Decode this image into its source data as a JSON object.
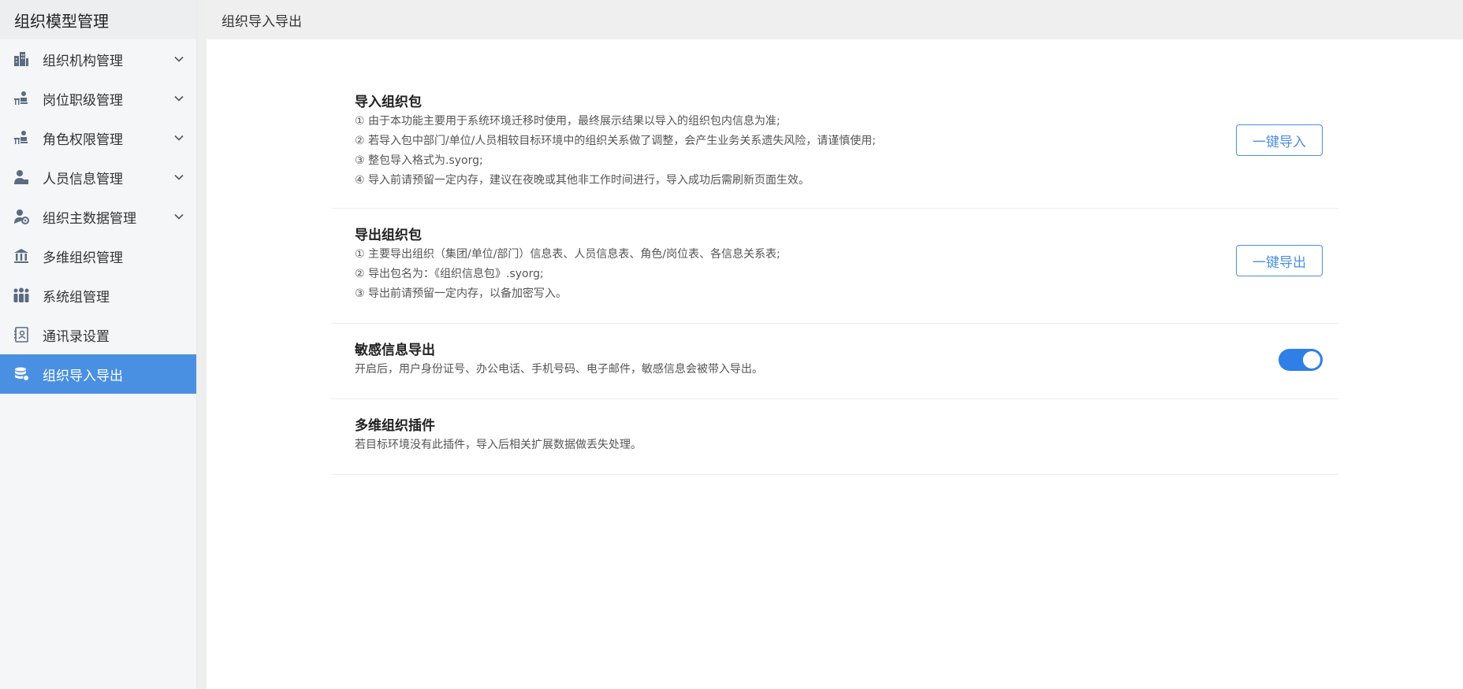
{
  "sidebar": {
    "title": "组织模型管理",
    "items": [
      {
        "label": "组织机构管理",
        "icon": "building-icon",
        "has_chevron": true
      },
      {
        "label": "岗位职级管理",
        "icon": "position-icon",
        "has_chevron": true
      },
      {
        "label": "角色权限管理",
        "icon": "role-icon",
        "has_chevron": true
      },
      {
        "label": "人员信息管理",
        "icon": "person-icon",
        "has_chevron": true
      },
      {
        "label": "组织主数据管理",
        "icon": "master-data-icon",
        "has_chevron": true
      },
      {
        "label": "多维组织管理",
        "icon": "institution-icon",
        "has_chevron": false
      },
      {
        "label": "系统组管理",
        "icon": "group-icon",
        "has_chevron": false
      },
      {
        "label": "通讯录设置",
        "icon": "contacts-icon",
        "has_chevron": false
      },
      {
        "label": "组织导入导出",
        "icon": "database-icon",
        "has_chevron": false,
        "active": true
      }
    ]
  },
  "header": {
    "title": "组织导入导出"
  },
  "sections": {
    "import": {
      "title": "导入组织包",
      "lines": [
        "① 由于本功能主要用于系统环境迁移时使用，最终展示结果以导入的组织包内信息为准;",
        "② 若导入包中部门/单位/人员相较目标环境中的组织关系做了调整，会产生业务关系遗失风险，请谨慎使用;",
        "③ 整包导入格式为.syorg;",
        "④ 导入前请预留一定内存，建议在夜晚或其他非工作时间进行，导入成功后需刷新页面生效。"
      ],
      "button": "一键导入"
    },
    "export": {
      "title": "导出组织包",
      "lines": [
        "① 主要导出组织（集团/单位/部门）信息表、人员信息表、角色/岗位表、各信息关系表;",
        "② 导出包名为：《组织信息包》.syorg;",
        "③ 导出前请预留一定内存，以备加密写入。"
      ],
      "button": "一键导出"
    },
    "sensitive": {
      "title": "敏感信息导出",
      "desc": "开启后，用户身份证号、办公电话、手机号码、电子邮件，敏感信息会被带入导出。",
      "toggle_on": true
    },
    "plugin": {
      "title": "多维组织插件",
      "desc": "若目标环境没有此插件，导入后相关扩展数据做丢失处理。"
    }
  },
  "colors": {
    "accent": "#4a90e2",
    "toggle": "#2f7fe6",
    "icon": "#5b6b82"
  }
}
